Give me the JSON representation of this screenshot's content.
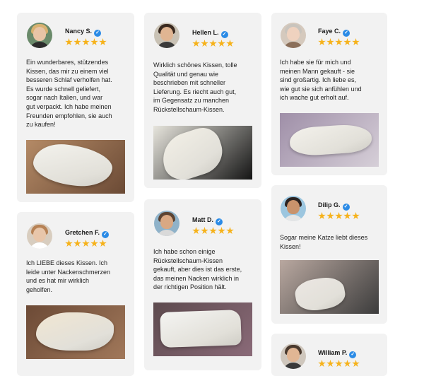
{
  "reviews": [
    {
      "name": "Nancy S.",
      "rating": 5,
      "text": "Ein wunderbares, stützendes\nKissen, das mir zu einem viel\nbesseren Schlaf verholfen hat.\nEs wurde schnell geliefert,\nsogar nach Italien, und war\ngut verpackt. Ich habe meinen\nFreunden empfohlen, sie auch\nzu kaufen!",
      "avatar": {
        "skin": "#e8c4a6",
        "hair": "#d8b170",
        "bg": "#6a8a6a",
        "top": "#2c2c2c"
      },
      "photo": {
        "bg": "#b48a66",
        "bg2": "#6b4a35",
        "pillow": "#f4f3ee"
      }
    },
    {
      "name": "Hellen L.",
      "rating": 5,
      "text": "Wirklich schönes Kissen, tolle\nQualität und genau wie\nbeschrieben mit schneller\nLieferung. Es riecht auch gut,\nim Gegensatz zu manchen\nRückstellschaum-Kissen.",
      "avatar": {
        "skin": "#e0b592",
        "hair": "#3a2a20",
        "bg": "#c9c2b5",
        "top": "#3a3a3a"
      },
      "photo": {
        "bg": "#e7e5dd",
        "bg2": "#141414",
        "pillow": "#f2efe6"
      }
    },
    {
      "name": "Faye C.",
      "rating": 5,
      "text": "Ich habe sie für mich und\nmeinen Mann gekauft - sie\nsind großartig. Ich liebe es,\nwie gut sie sich anfühlen und\nich wache gut erholt auf.",
      "avatar": {
        "skin": "#efd2bf",
        "hair": "#c9c4bd",
        "bg": "#d5c9bd",
        "top": "#8b6f5a"
      },
      "photo": {
        "bg": "#9f8fa8",
        "bg2": "#d6cfd8",
        "pillow": "#f3f1eb"
      }
    },
    {
      "name": "Gretchen F.",
      "rating": 5,
      "text": "Ich LIEBE dieses Kissen. Ich\nleide unter Nackenschmerzen\nund es hat mir wirklich\ngeholfen.",
      "avatar": {
        "skin": "#e8c6aa",
        "hair": "#b78255",
        "bg": "#d8cdbf",
        "top": "#ffffff"
      },
      "photo": {
        "bg": "#6c4a36",
        "bg2": "#a1785a",
        "pillow": "#f1e6d2"
      }
    },
    {
      "name": "Matt D.",
      "rating": 5,
      "text": "Ich habe schon einige\nRückstellschaum-Kissen\ngekauft, aber dies ist das erste,\ndas meinen Nacken wirklich in\nder richtigen Position hält.",
      "avatar": {
        "skin": "#d9a883",
        "hair": "#5b4332",
        "bg": "#8fb2c9",
        "top": "#d9d9d9"
      },
      "photo": {
        "bg": "#5d4a4e",
        "bg2": "#8a6a78",
        "pillow": "#f4f4f2"
      }
    },
    {
      "name": "Dilip G.",
      "rating": 5,
      "text": "Sogar meine Katze liebt dieses\nKissen!",
      "avatar": {
        "skin": "#c9936c",
        "hair": "#2a2220",
        "bg": "#9cc6df",
        "top": "#e6e6e6"
      },
      "photo": {
        "bg": "#b9a8a0",
        "bg2": "#3c3c3c",
        "pillow": "#ebe6e2"
      }
    },
    {
      "name": "William P.",
      "rating": 5,
      "text": "",
      "avatar": {
        "skin": "#e1b694",
        "hair": "#4a3a2e",
        "bg": "#cfc7bd",
        "top": "#3a3a3a"
      },
      "photo": {
        "bg": "#ffffff",
        "bg2": "#ffffff",
        "pillow": "#ffffff"
      }
    }
  ]
}
